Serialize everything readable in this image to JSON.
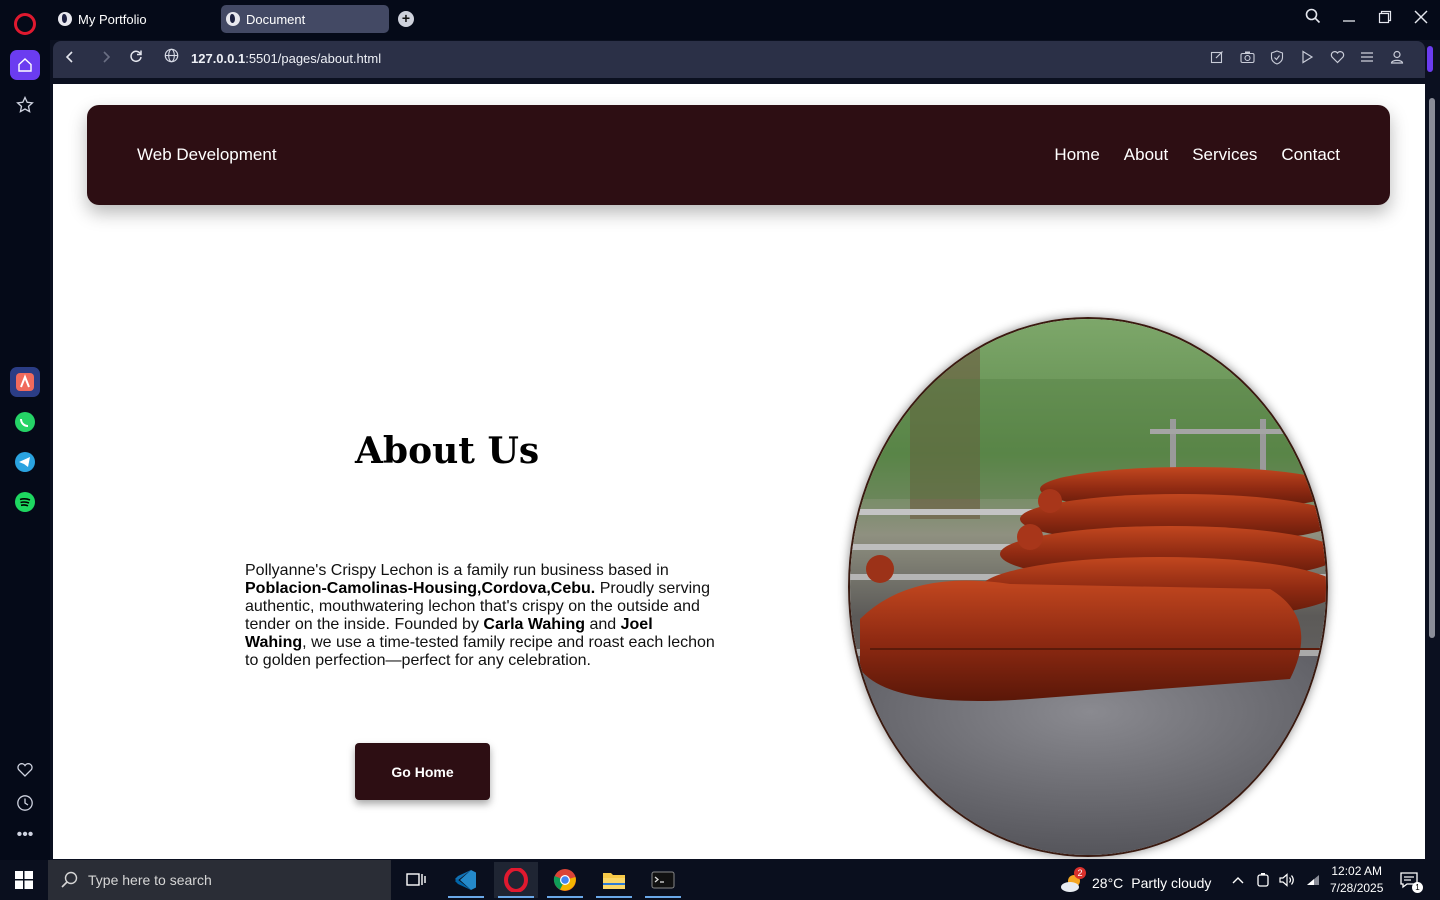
{
  "browser": {
    "tabs": [
      {
        "label": "My Portfolio"
      },
      {
        "label": "Document"
      }
    ],
    "url_host": "127.0.0.1",
    "url_path": ":5501/pages/about.html"
  },
  "site": {
    "brand": "Web Development",
    "nav": [
      "Home",
      "About",
      "Services",
      "Contact"
    ],
    "about_title": "About Us",
    "about_text": {
      "p1": "Pollyanne's Crispy Lechon is a family run business based in ",
      "location": "Poblacion-Camolinas-Housing,Cordova,Cebu.",
      "p2": " Proudly serving authentic, mouthwatering lechon that's crispy on the outside and tender on the inside. Founded by ",
      "founder1": "Carla Wahing",
      "p3": " and ",
      "founder2": "Joel Wahing",
      "p4": ", we use a time-tested family recipe and roast each lechon to golden perfection—perfect for any celebration."
    },
    "go_home_label": "Go Home",
    "colors": {
      "accent": "#2d0e13"
    }
  },
  "taskbar": {
    "search_placeholder": "Type here to search",
    "weather_temp": "28°C",
    "weather_desc": "Partly cloudy",
    "weather_badge": "2",
    "time": "12:02 AM",
    "date": "7/28/2025",
    "notifications": "1"
  }
}
